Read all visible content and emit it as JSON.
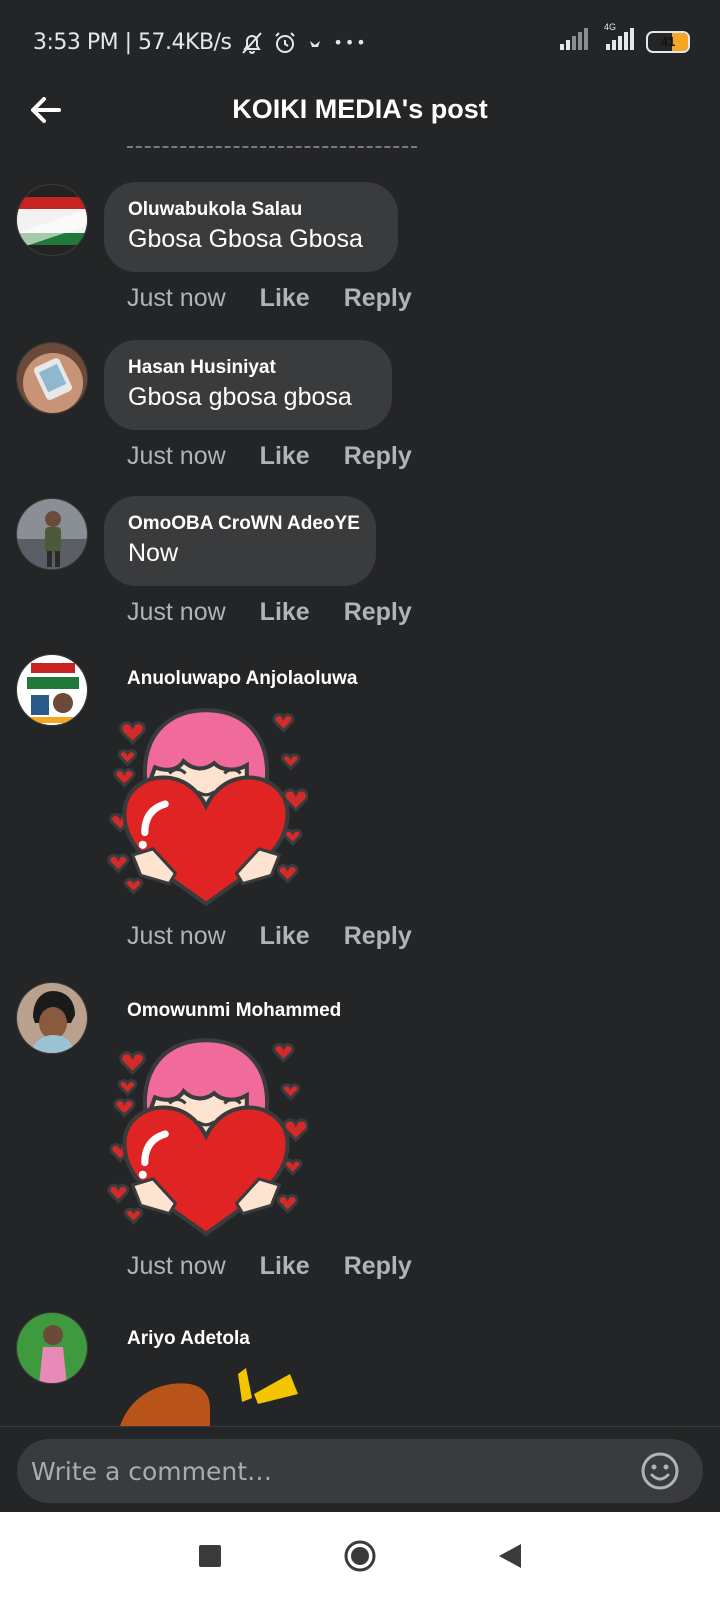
{
  "status_bar": {
    "time_speed": "3:53 PM | 57.4KB/s",
    "more": "•••",
    "network": "4G",
    "battery": "41",
    "battery_level": 0.41
  },
  "header": {
    "title": "KOIKI MEDIA's post",
    "back_icon": "arrow-left-icon"
  },
  "comments": [
    {
      "author": "Oluwabukola Salau",
      "text": "Gbosa Gbosa Gbosa",
      "time": "Just now",
      "like": "Like",
      "reply": "Reply"
    },
    {
      "author": "Hasan Husiniyat",
      "text": "Gbosa gbosa gbosa",
      "time": "Just now",
      "like": "Like",
      "reply": "Reply"
    },
    {
      "author": "OmoOBA CroWN AdeoYE",
      "text": "Now",
      "time": "Just now",
      "like": "Like",
      "reply": "Reply"
    },
    {
      "author": "Anuoluwapo Anjolaoluwa",
      "sticker": "heart-hug-sticker",
      "time": "Just now",
      "like": "Like",
      "reply": "Reply"
    },
    {
      "author": "Omowunmi Mohammed",
      "sticker": "heart-hug-sticker",
      "time": "Just now",
      "like": "Like",
      "reply": "Reply"
    },
    {
      "author": "Ariyo Adetola",
      "sticker": "partial-sticker"
    }
  ],
  "composer": {
    "placeholder": "Write a comment…",
    "emoji_icon": "smiley-icon"
  },
  "nav": {
    "icons": [
      "recents-square-icon",
      "home-circle-icon",
      "back-triangle-icon"
    ]
  },
  "colors": {
    "background": "#242526",
    "bubble": "#3a3b3c",
    "secondary_text": "#b0b3b8",
    "battery": "#f5a623"
  }
}
